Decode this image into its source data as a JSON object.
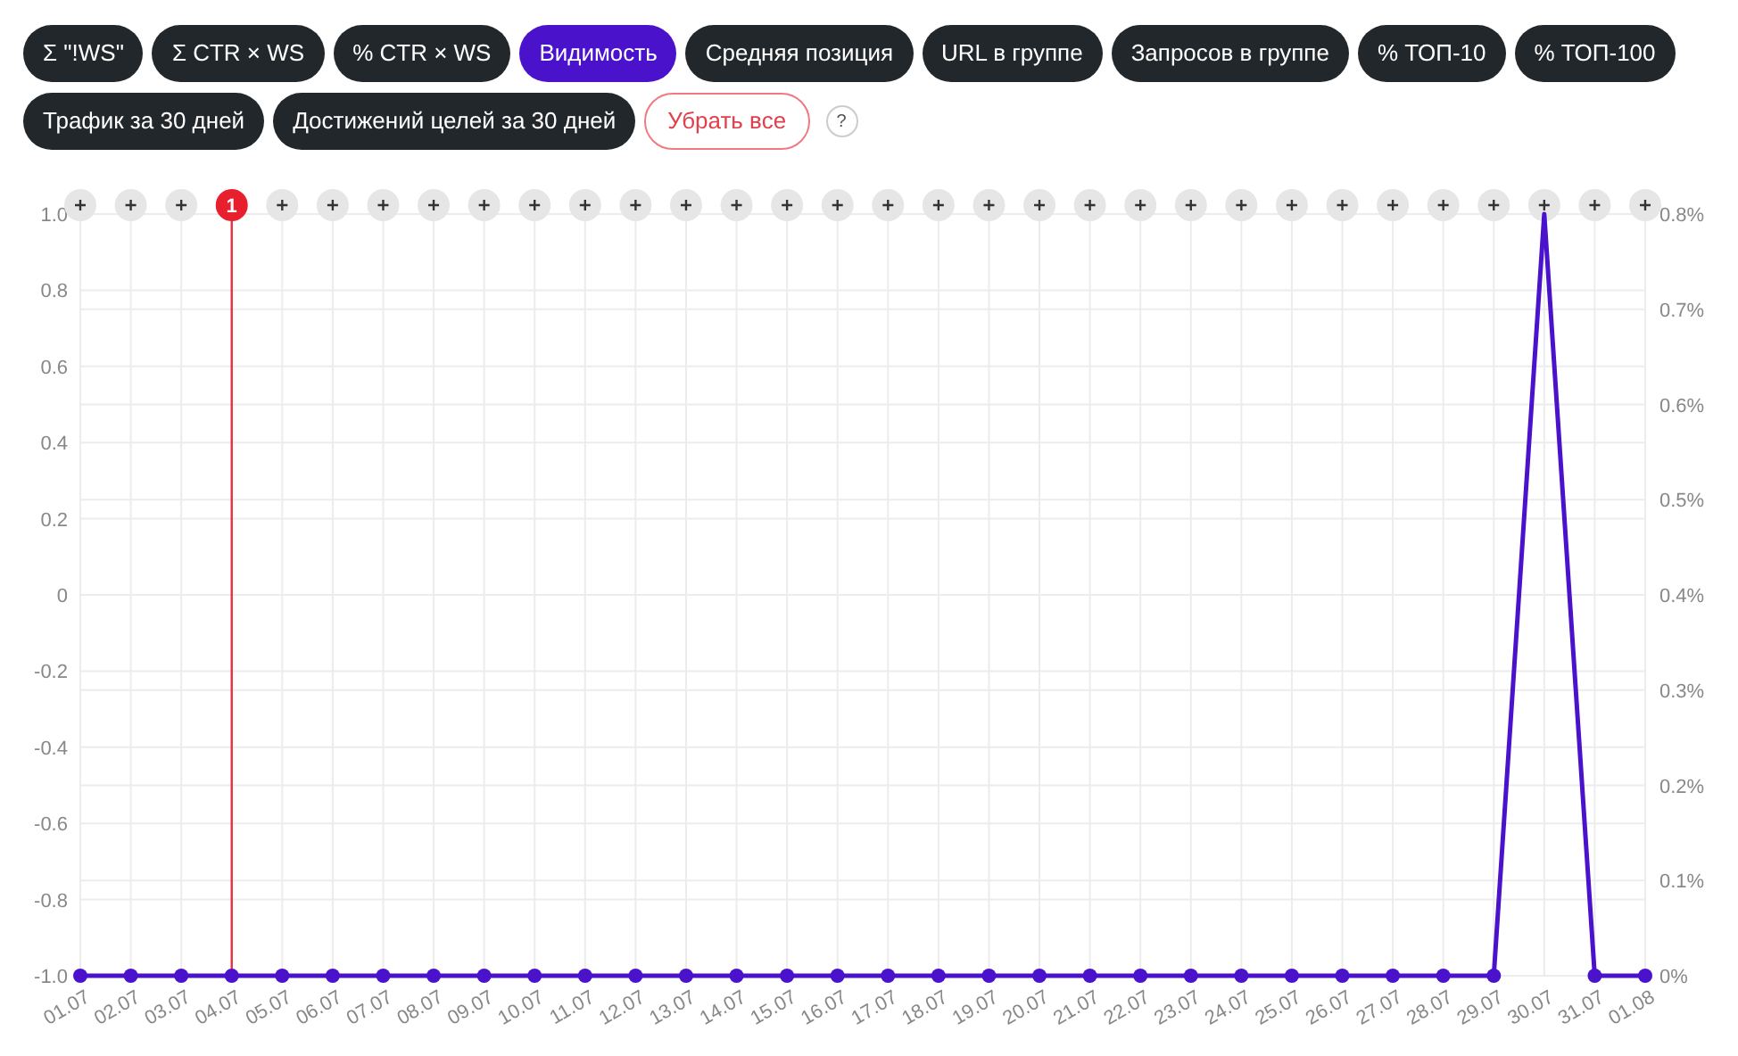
{
  "filters": [
    {
      "label": "Σ \"!WS\"",
      "selected": false
    },
    {
      "label": "Σ CTR × WS",
      "selected": false
    },
    {
      "label": "% CTR × WS",
      "selected": false
    },
    {
      "label": "Видимость",
      "selected": true
    },
    {
      "label": "Средняя позиция",
      "selected": false
    },
    {
      "label": "URL в группе",
      "selected": false
    },
    {
      "label": "Запросов в группе",
      "selected": false
    },
    {
      "label": "% ТОП-10",
      "selected": false
    },
    {
      "label": "% ТОП-100",
      "selected": false
    },
    {
      "label": "Трафик за 30 дней",
      "selected": false
    },
    {
      "label": "Достижений целей за 30 дней",
      "selected": false
    }
  ],
  "clear_button": "Убрать все",
  "help": "?",
  "left_axis_labels": [
    "1.0",
    "0.8",
    "0.6",
    "0.4",
    "0.2",
    "0",
    "-0.2",
    "-0.4",
    "-0.6",
    "-0.8",
    "-1.0"
  ],
  "chart_data": {
    "type": "line",
    "categories": [
      "01.07",
      "02.07",
      "03.07",
      "04.07",
      "05.07",
      "06.07",
      "07.07",
      "08.07",
      "09.07",
      "10.07",
      "11.07",
      "12.07",
      "13.07",
      "14.07",
      "15.07",
      "16.07",
      "17.07",
      "18.07",
      "19.07",
      "20.07",
      "21.07",
      "22.07",
      "23.07",
      "24.07",
      "25.07",
      "26.07",
      "27.07",
      "28.07",
      "29.07",
      "30.07",
      "31.07",
      "01.08"
    ],
    "series": [
      {
        "color": "#4b12cc",
        "marker": "circle",
        "values": [
          0,
          0,
          0,
          0,
          0,
          0,
          0,
          0,
          0,
          0,
          0,
          0,
          0,
          0,
          0,
          0,
          0,
          0,
          0,
          0,
          0,
          0,
          0,
          0,
          0,
          0,
          0,
          0,
          0,
          0.8,
          0,
          0
        ]
      }
    ],
    "ylim": [
      0,
      0.8
    ],
    "yticks": [
      {
        "value": 0,
        "label": "0%"
      },
      {
        "value": 0.1,
        "label": "0.1%"
      },
      {
        "value": 0.2,
        "label": "0.2%"
      },
      {
        "value": 0.3,
        "label": "0.3%"
      },
      {
        "value": 0.4,
        "label": "0.4%"
      },
      {
        "value": 0.5,
        "label": "0.5%"
      },
      {
        "value": 0.6,
        "label": "0.6%"
      },
      {
        "value": 0.7,
        "label": "0.7%"
      },
      {
        "value": 0.8,
        "label": "0.8%"
      }
    ],
    "grid": true,
    "annotations": [
      {
        "x": "04.07",
        "text": "1"
      }
    ]
  }
}
